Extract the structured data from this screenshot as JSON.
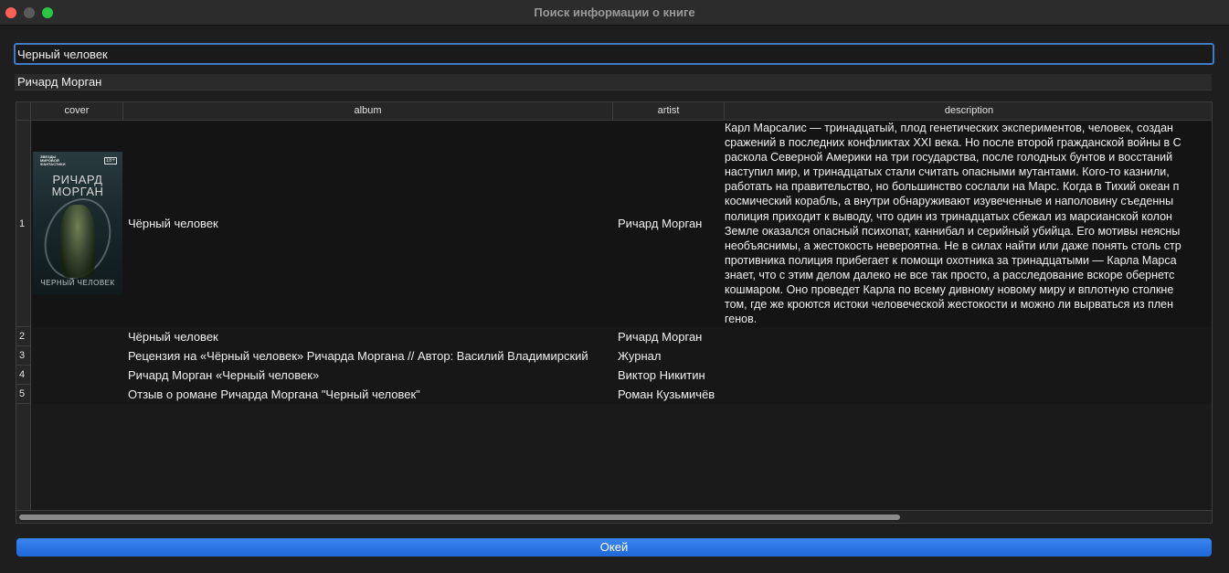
{
  "window": {
    "title": "Поиск информации о книге"
  },
  "search": {
    "value": "Черный человек"
  },
  "author_field": {
    "value": "Ричард Морган"
  },
  "table": {
    "columns": [
      "cover",
      "album",
      "artist",
      "description"
    ],
    "rows": [
      {
        "num": "1",
        "album": "Чёрный человек",
        "artist": "Ричард Морган",
        "description_lines": [
          "Карл Марсалис — тринадцатый, плод генетических экспериментов, человек, создан",
          "сражений в последних конфликтах XXI века. Но после второй гражданской войны в С",
          "раскола Северной Америки на три государства, после голодных бунтов и восстаний",
          "наступил мир, и тринадцатых стали считать опасными мутантами. Кого-то казнили,",
          "работать на правительство, но большинство сослали на Марс. Когда в Тихий океан п",
          "космический корабль, а внутри обнаруживают изувеченные и наполовину съеденны",
          "полиция приходит к выводу, что один из тринадцатых сбежал из марсианской колон",
          "Земле оказался опасный психопат, каннибал и серийный убийца. Его мотивы неясны",
          "необъяснимы, а жестокость невероятна. Не в силах найти или даже понять столь стр",
          "противника полиция прибегает к помощи охотника за тринадцатыми — Карла Марса",
          "знает, что с этим делом далеко не все так просто, а расследование вскоре обернетс",
          "кошмаром. Оно проведет Карла по всему дивному новому миру и вплотную столкне",
          "том, где же кроются истоки человеческой жестокости и можно ли вырваться из плен",
          "генов."
        ],
        "cover": {
          "publisher": "ЗВЕЗДЫ\nМИРОВОЙ\nФАНТАСТИКИ",
          "age": "18+",
          "author": "РИЧАРД\nМОРГАН",
          "title": "ЧЕРНЫЙ ЧЕЛОВЕК"
        }
      },
      {
        "num": "2",
        "album": "Чёрный человек",
        "artist": "Ричард Морган"
      },
      {
        "num": "3",
        "album": "Рецензия на «Чёрный человек» Ричарда Моргана // Автор: Василий Владимирский",
        "artist": "Журнал"
      },
      {
        "num": "4",
        "album": "Ричард Морган «Черный человек»",
        "artist": "Виктор Никитин"
      },
      {
        "num": "5",
        "album": "Отзыв о романе Ричарда Моргана \"Черный человек\"",
        "artist": "Роман Кузьмичёв"
      }
    ]
  },
  "ok_button": {
    "label": "Окей"
  },
  "colors": {
    "accent": "#1f66d6",
    "focus_ring": "#3d7cc4"
  }
}
